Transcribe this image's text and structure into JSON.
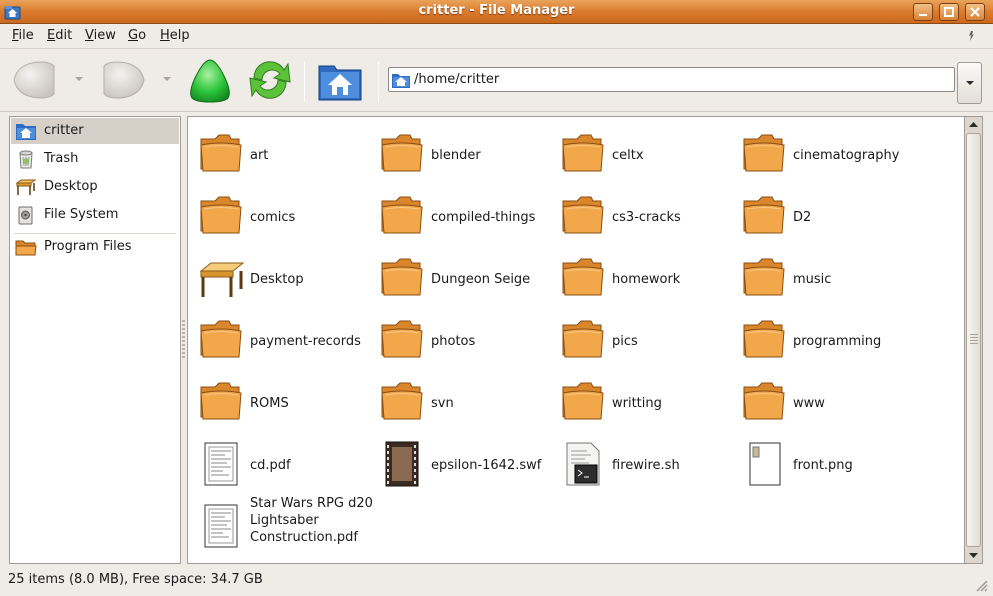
{
  "window": {
    "title": "critter - File Manager"
  },
  "menu": [
    {
      "label": "File",
      "key": "F",
      "rest": "ile"
    },
    {
      "label": "Edit",
      "key": "E",
      "rest": "dit"
    },
    {
      "label": "View",
      "key": "V",
      "rest": "iew"
    },
    {
      "label": "Go",
      "key": "G",
      "rest": "o"
    },
    {
      "label": "Help",
      "key": "H",
      "rest": "elp"
    }
  ],
  "toolbar": {
    "buttons": [
      "back-icon",
      "forward-icon",
      "up-icon",
      "reload-icon",
      "home-icon"
    ]
  },
  "location": {
    "path": "/home/critter"
  },
  "sidebar": {
    "items": [
      {
        "label": "critter",
        "icon": "home-folder-icon",
        "selected": true
      },
      {
        "label": "Trash",
        "icon": "trash-icon"
      },
      {
        "label": "Desktop",
        "icon": "desktop-icon"
      },
      {
        "label": "File System",
        "icon": "filesystem-icon"
      },
      {
        "label": "Program Files",
        "icon": "folder-icon"
      }
    ]
  },
  "files": [
    {
      "name": "art",
      "type": "folder"
    },
    {
      "name": "blender",
      "type": "folder"
    },
    {
      "name": "celtx",
      "type": "folder"
    },
    {
      "name": "cinematography",
      "type": "folder"
    },
    {
      "name": "comics",
      "type": "folder"
    },
    {
      "name": "compiled-things",
      "type": "folder"
    },
    {
      "name": "cs3-cracks",
      "type": "folder"
    },
    {
      "name": "D2",
      "type": "folder"
    },
    {
      "name": "Desktop",
      "type": "desktop"
    },
    {
      "name": "Dungeon Seige",
      "type": "folder"
    },
    {
      "name": "homework",
      "type": "folder"
    },
    {
      "name": "music",
      "type": "folder"
    },
    {
      "name": "payment-records",
      "type": "folder"
    },
    {
      "name": "photos",
      "type": "folder"
    },
    {
      "name": "pics",
      "type": "folder"
    },
    {
      "name": "programming",
      "type": "folder"
    },
    {
      "name": "ROMS",
      "type": "folder"
    },
    {
      "name": "svn",
      "type": "folder"
    },
    {
      "name": "writting",
      "type": "folder"
    },
    {
      "name": "www",
      "type": "folder"
    },
    {
      "name": "cd.pdf",
      "type": "pdf"
    },
    {
      "name": "epsilon-1642.swf",
      "type": "video"
    },
    {
      "name": "firewire.sh",
      "type": "script"
    },
    {
      "name": "front.png",
      "type": "image"
    },
    {
      "name": "Star Wars RPG d20 Lightsaber Construction.pdf",
      "type": "pdf",
      "lines": [
        "Star Wars RPG d20",
        "Lightsaber",
        "Construction.pdf"
      ]
    }
  ],
  "status": {
    "text": "25 items (8.0 MB), Free space: 34.7 GB"
  },
  "colors": {
    "titlebar": "#d9782b",
    "folder": "#f0a040",
    "selection": "#d6d0c8"
  }
}
